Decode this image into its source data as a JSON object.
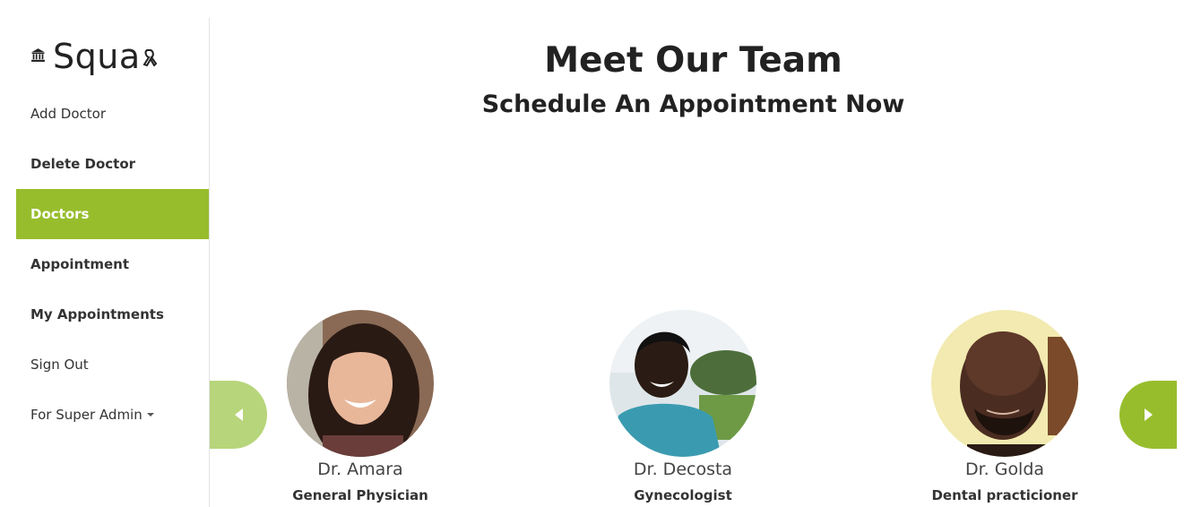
{
  "brand": {
    "name": "Squa",
    "left_icon": "bank-icon",
    "right_icon": "ribbon-icon"
  },
  "nav": {
    "items": [
      {
        "label": "Add Doctor"
      },
      {
        "label": "Delete Doctor"
      },
      {
        "label": "Doctors"
      },
      {
        "label": "Appointment"
      },
      {
        "label": "My Appointments"
      },
      {
        "label": "Sign Out"
      },
      {
        "label": "For Super Admin"
      }
    ],
    "active_index": 2
  },
  "main": {
    "title": "Meet Our Team",
    "subtitle": "Schedule An Appointment Now"
  },
  "carousel": {
    "prev_icon": "caret-left-icon",
    "next_icon": "caret-right-icon",
    "doctors": [
      {
        "name": "Dr. Amara",
        "specialty": "General Physician"
      },
      {
        "name": "Dr. Decosta",
        "specialty": "Gynecologist"
      },
      {
        "name": "Dr. Golda",
        "specialty": "Dental practicioner"
      }
    ]
  },
  "colors": {
    "accent": "#97bd2d",
    "accent_light": "#b7d57a",
    "text": "#333333"
  }
}
